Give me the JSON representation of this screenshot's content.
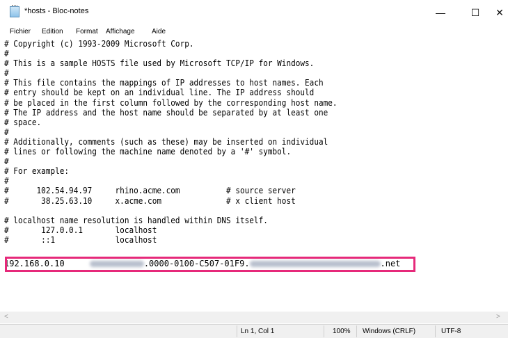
{
  "window": {
    "title": "*hosts - Bloc-notes",
    "minimize": "—",
    "maximize": "☐",
    "close": "✕"
  },
  "menu": [
    "Fichier",
    "Edition",
    "Format",
    "Affichage",
    "Aide"
  ],
  "editor": {
    "text": "# Copyright (c) 1993-2009 Microsoft Corp.\n#\n# This is a sample HOSTS file used by Microsoft TCP/IP for Windows.\n#\n# This file contains the mappings of IP addresses to host names. Each\n# entry should be kept on an individual line. The IP address should\n# be placed in the first column followed by the corresponding host name.\n# The IP address and the host name should be separated by at least one\n# space.\n#\n# Additionally, comments (such as these) may be inserted on individual\n# lines or following the machine name denoted by a '#' symbol.\n#\n# For example:\n#\n#      102.54.94.97     rhino.acme.com          # source server\n#       38.25.63.10     x.acme.com              # x client host\n\n# localhost name resolution is handled within DNS itself.\n#\t127.0.0.1       localhost\n#\t::1             localhost",
    "host_line": {
      "ip": "192.168.0.10",
      "segment": ".0000-0100-C507-01F9.",
      "suffix": ".net"
    }
  },
  "status": {
    "position": "Ln 1, Col 1",
    "zoom": "100%",
    "line_ending": "Windows (CRLF)",
    "encoding": "UTF-8"
  },
  "colors": {
    "highlight": "#e6297a"
  }
}
